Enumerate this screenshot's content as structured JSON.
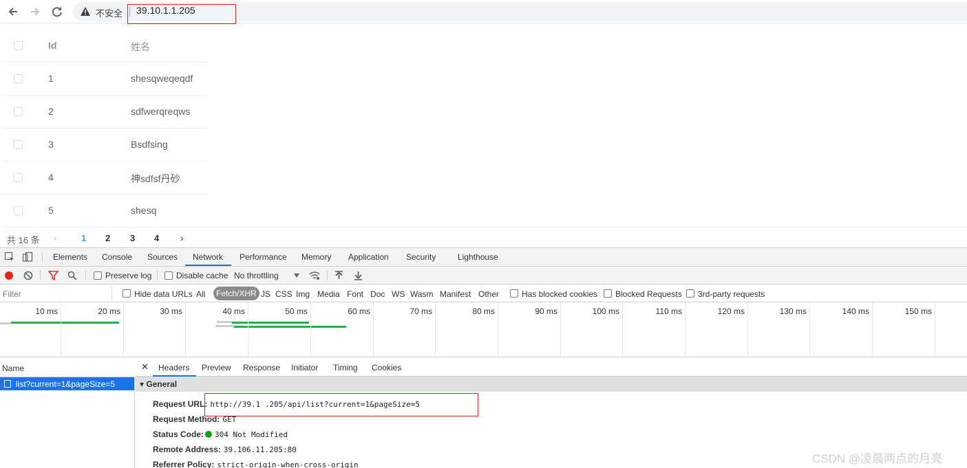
{
  "browser": {
    "security_label": "不安全",
    "url_display": "39.10.1.1.205"
  },
  "table": {
    "header": {
      "id": "Id",
      "name": "姓名"
    },
    "rows": [
      {
        "id": "1",
        "name": "shesqweqeqdf"
      },
      {
        "id": "2",
        "name": "sdfwerqreqws"
      },
      {
        "id": "3",
        "name": "Bsdfsing"
      },
      {
        "id": "4",
        "name": "神sdfsf丹砂"
      },
      {
        "id": "5",
        "name": "shesq"
      }
    ]
  },
  "pagination": {
    "total_label": "共 16 条",
    "prev": "‹",
    "pages": [
      "1",
      "2",
      "3",
      "4"
    ],
    "current": "1",
    "next": "›"
  },
  "devtools": {
    "tabs": [
      "Elements",
      "Console",
      "Sources",
      "Network",
      "Performance",
      "Memory",
      "Application",
      "Security",
      "Lighthouse"
    ],
    "active_tab": "Network",
    "toolbar": {
      "preserve_log": "Preserve log",
      "disable_cache": "Disable cache",
      "throttling": "No throttling"
    },
    "filter": {
      "placeholder": "Filter",
      "hide_data_urls": "Hide data URLs",
      "types": [
        "All",
        "Fetch/XHR",
        "JS",
        "CSS",
        "Img",
        "Media",
        "Font",
        "Doc",
        "WS",
        "Wasm",
        "Manifest",
        "Other"
      ],
      "active_type": "Fetch/XHR",
      "has_blocked_cookies": "Has blocked cookies",
      "blocked_requests": "Blocked Requests",
      "third_party": "3rd-party requests"
    },
    "timeline_ticks": [
      "10 ms",
      "20 ms",
      "30 ms",
      "40 ms",
      "50 ms",
      "60 ms",
      "70 ms",
      "80 ms",
      "90 ms",
      "100 ms",
      "110 ms",
      "120 ms",
      "130 ms",
      "140 ms",
      "150 ms"
    ],
    "requests": {
      "column": "Name",
      "items": [
        "list?current=1&pageSize=5"
      ]
    },
    "detail": {
      "tabs": [
        "Headers",
        "Preview",
        "Response",
        "Initiator",
        "Timing",
        "Cookies"
      ],
      "active_tab": "Headers",
      "section": "General",
      "fields": [
        {
          "key": "Request URL:",
          "value": "http://39.1 .205/api/list?current=1&pageSize=5"
        },
        {
          "key": "Request Method:",
          "value": "GET"
        },
        {
          "key": "Status Code:",
          "value": "304 Not Modified"
        },
        {
          "key": "Remote Address:",
          "value": "39.106.11.205:80"
        },
        {
          "key": "Referrer Policy:",
          "value": "strict-origin-when-cross-origin"
        }
      ]
    }
  },
  "watermark": "CSDN @凌晨两点的月亮",
  "colors": {
    "accent": "#1a73e8",
    "page_active": "#409eff",
    "annotation_red": "#e02020",
    "status_green": "#0ca40c",
    "timeline_green": "#20b050"
  }
}
